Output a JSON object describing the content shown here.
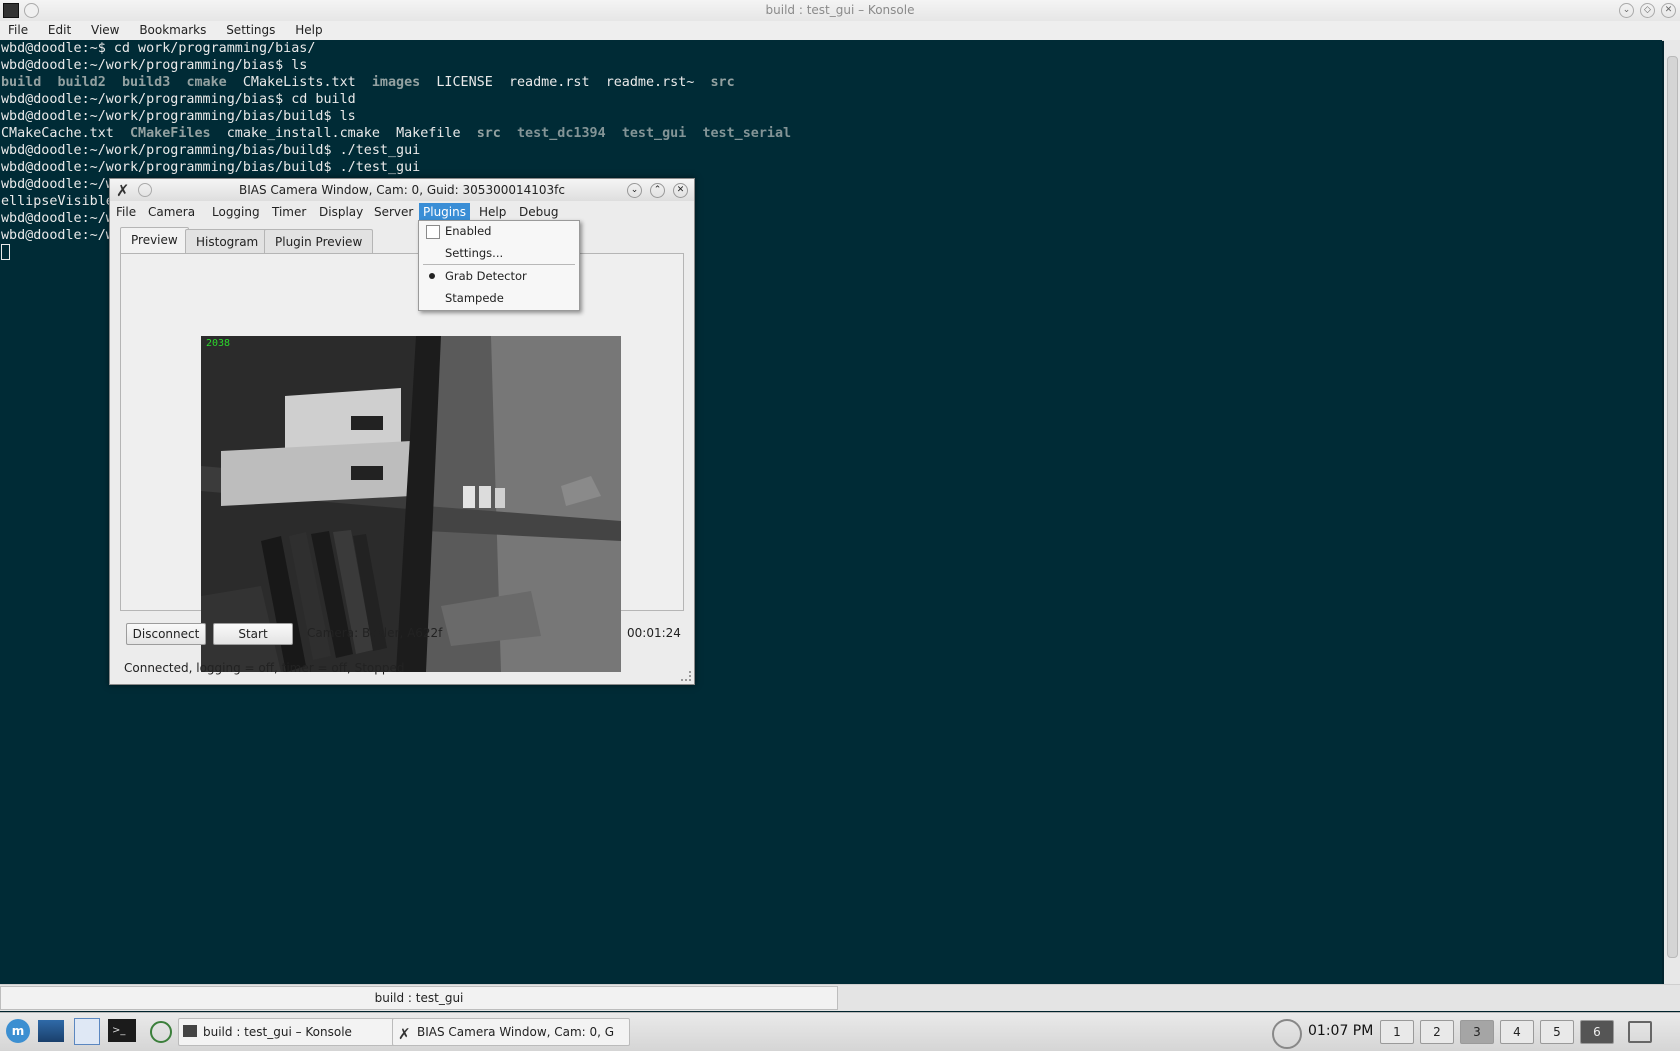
{
  "konsole": {
    "title": "build : test_gui – Konsole",
    "menu": [
      "File",
      "Edit",
      "View",
      "Bookmarks",
      "Settings",
      "Help"
    ],
    "lines": [
      "wbd@doodle:~$ cd work/programming/bias/",
      "wbd@doodle:~/work/programming/bias$ ls",
      null,
      "wbd@doodle:~/work/programming/bias$ cd build",
      "wbd@doodle:~/work/programming/bias/build$ ls",
      null,
      "wbd@doodle:~/work/programming/bias/build$ ./test_gui",
      "wbd@doodle:~/work/programming/bias/build$ ./test_gui",
      "wbd@doodle:~/w",
      "ellipseVisible",
      "wbd@doodle:~/w",
      "wbd@doodle:~/w"
    ],
    "ls1": {
      "build": "build",
      "build2": "build2",
      "build3": "build3",
      "cmake": "cmake",
      "cmakelists": "CMakeLists.txt",
      "images": "images",
      "license": "LICENSE",
      "readme": "readme.rst",
      "readme_bak": "readme.rst~",
      "src": "src"
    },
    "ls2": {
      "cache": "CMakeCache.txt",
      "cmakefiles": "CMakeFiles",
      "install": "cmake_install.cmake",
      "makefile": "Makefile",
      "src": "src",
      "dc1394": "test_dc1394",
      "gui": "test_gui",
      "serial": "test_serial"
    },
    "tab_label": "build : test_gui"
  },
  "bias": {
    "title": "BIAS Camera Window, Cam: 0, Guid: 305300014103fc",
    "menu": [
      "File",
      "Camera",
      "Logging",
      "Timer",
      "Display",
      "Server",
      "Plugins",
      "Help",
      "Debug"
    ],
    "tabs": [
      "Preview",
      "Histogram",
      "Plugin Preview"
    ],
    "frame_count": "2038",
    "disconnect": "Disconnect",
    "start": "Start",
    "camera_info": "Camera:  Basler,  A622f",
    "elapsed": "00:01:24",
    "status": "Connected, logging = off, timer = off, Stopped",
    "plugins_menu": {
      "enabled": "Enabled",
      "settings": "Settings...",
      "grab_detector": "Grab Detector",
      "stampede": "Stampede"
    }
  },
  "taskbar": {
    "task1": "build : test_gui – Konsole",
    "task2": "BIAS Camera Window, Cam: 0, G",
    "clock": "01:07 PM",
    "desktops": [
      "1",
      "2",
      "3",
      "4",
      "5",
      "6"
    ]
  }
}
